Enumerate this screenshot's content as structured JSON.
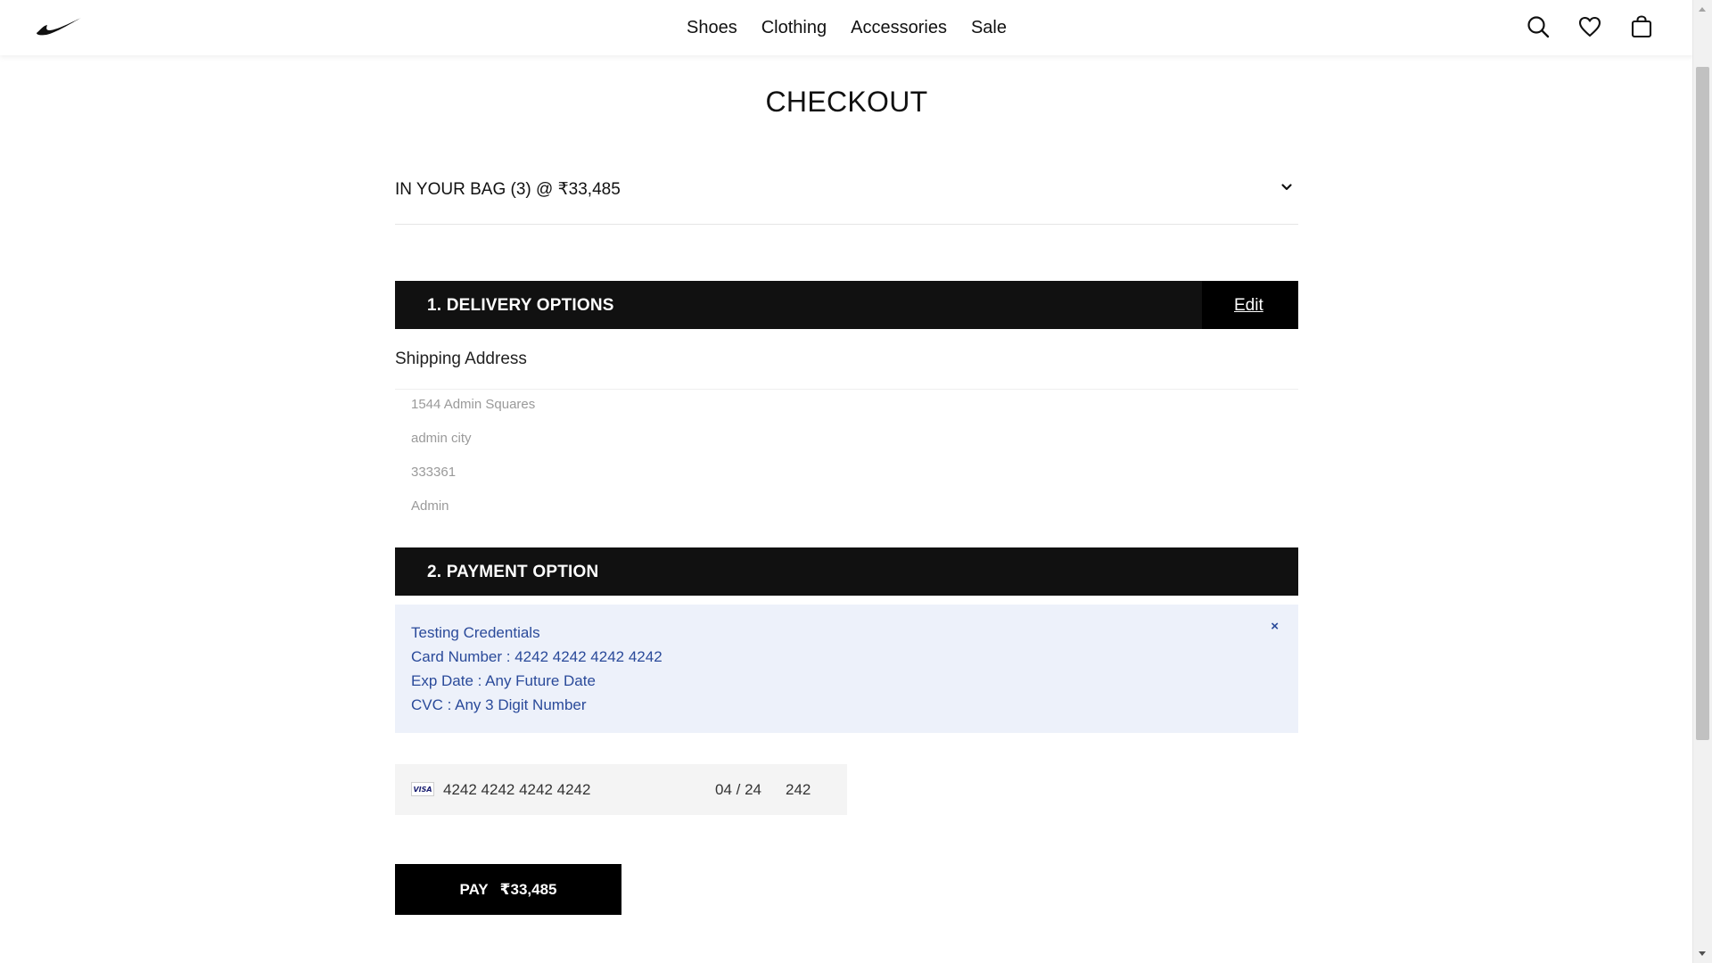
{
  "header": {
    "logo": "swoosh-logo",
    "nav": [
      "Shoes",
      "Clothing",
      "Accessories",
      "Sale"
    ],
    "icons": [
      "search-icon",
      "heart-icon",
      "bag-icon"
    ]
  },
  "checkout": {
    "title": "CHECKOUT",
    "bag_summary": "IN YOUR BAG (3) @ ₹33,485"
  },
  "delivery": {
    "heading": "1. DELIVERY OPTIONS",
    "edit_label": "Edit",
    "shipping_heading": "Shipping Address",
    "address": [
      "1544 Admin Squares",
      "admin city",
      "333361",
      "Admin"
    ]
  },
  "payment": {
    "heading": "2. PAYMENT OPTION",
    "credentials": {
      "title": "Testing Credentials",
      "card_number": "Card Number : 4242 4242 4242 4242",
      "exp": "Exp Date : Any Future Date",
      "cvc": "CVC : Any 3 Digit Number",
      "close_label": "×"
    },
    "card": {
      "brand": "VISA",
      "number": "4242 4242 4242 4242",
      "expiry": "04 / 24",
      "cvc": "242"
    },
    "pay_label": "PAY",
    "pay_amount": "₹33,485"
  },
  "colors": {
    "bar": "#111111",
    "credentials_bg": "#edf1fa",
    "credentials_text": "#2a4a9a",
    "card_bg": "#f4f4f4"
  }
}
